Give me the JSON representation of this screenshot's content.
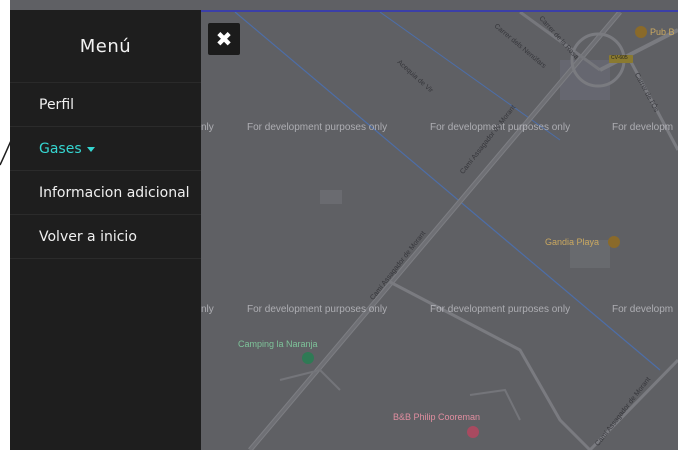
{
  "menu": {
    "title": "Menú",
    "items": [
      {
        "label": "Perfil"
      },
      {
        "label": "Gases",
        "active": true
      },
      {
        "label": "Informacion adicional"
      },
      {
        "label": "Volver a inicio"
      }
    ]
  },
  "close_button": {
    "icon": "close-icon",
    "glyph": "✖"
  },
  "map": {
    "watermark": "For development purposes only",
    "watermark_left_fragment": "nly",
    "watermark_right_fragment": "For developm",
    "pois": [
      {
        "label": "Gandia Playa"
      },
      {
        "label": "Camping la Naranja"
      },
      {
        "label": "B&B Philip Cooreman"
      },
      {
        "label": "Pub B"
      }
    ],
    "streets": [
      {
        "label": "Carrer de la Rosa"
      },
      {
        "label": "Carrer dels Nenúfars"
      },
      {
        "label": "Acequia de Vir"
      },
      {
        "label": "Camí Assagador de Morant"
      },
      {
        "label": "Camí Assagador de Morant"
      },
      {
        "label": "Camí Assagador de Morant"
      },
      {
        "label": "Carrer de l'Ós"
      },
      {
        "label": "CV-605"
      }
    ]
  },
  "colors": {
    "menu_bg": "#1e1e1e",
    "active": "#35d6d1",
    "map_bg": "#5f6064"
  }
}
